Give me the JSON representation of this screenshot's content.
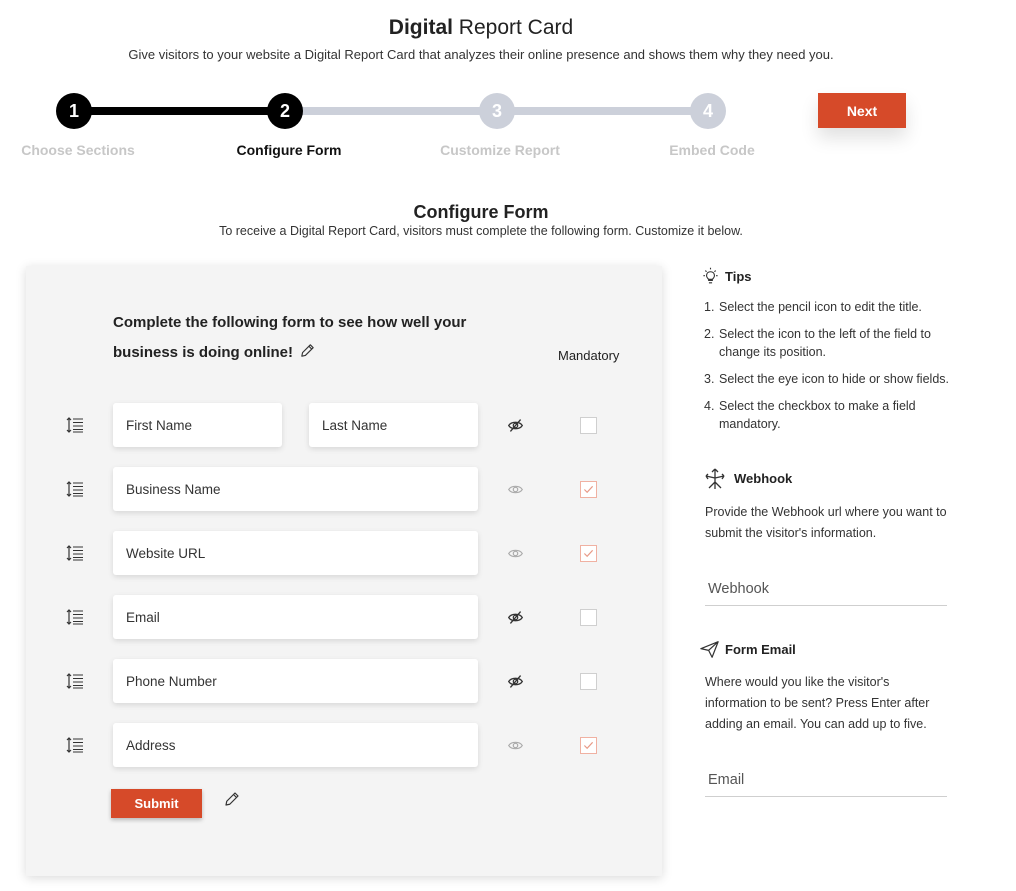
{
  "header": {
    "title_bold": "Digital",
    "title_rest": " Report Card",
    "subtitle": "Give visitors to your website a Digital Report Card that analyzes their online presence and shows them why they need you."
  },
  "steps": [
    {
      "number": "1",
      "label": "Choose Sections",
      "state": "done"
    },
    {
      "number": "2",
      "label": "Configure Form",
      "state": "active"
    },
    {
      "number": "3",
      "label": "Customize Report",
      "state": "pending"
    },
    {
      "number": "4",
      "label": "Embed Code",
      "state": "pending"
    }
  ],
  "next_label": "Next",
  "section": {
    "title": "Configure Form",
    "subtitle": "To receive a Digital Report Card, visitors must complete the following form. Customize it below."
  },
  "form": {
    "heading": "Complete the following form to see how well your business is doing online!",
    "mandatory_label": "Mandatory",
    "rows": [
      {
        "fields": [
          "First Name",
          "Last Name"
        ],
        "visible": false,
        "mandatory": false
      },
      {
        "fields": [
          "Business Name"
        ],
        "visible": true,
        "mandatory": true
      },
      {
        "fields": [
          "Website URL"
        ],
        "visible": true,
        "mandatory": true
      },
      {
        "fields": [
          "Email"
        ],
        "visible": false,
        "mandatory": false
      },
      {
        "fields": [
          "Phone Number"
        ],
        "visible": false,
        "mandatory": false
      },
      {
        "fields": [
          "Address"
        ],
        "visible": true,
        "mandatory": true
      }
    ],
    "submit_label": "Submit"
  },
  "tips": {
    "title": "Tips",
    "items": [
      "Select the pencil icon to edit the title.",
      "Select the icon to the left of the field to change its position.",
      "Select the eye icon to hide or show fields.",
      "Select the checkbox to make a field mandatory."
    ]
  },
  "webhook": {
    "title": "Webhook",
    "description": "Provide the Webhook url where you want to submit the visitor's information.",
    "placeholder": "Webhook"
  },
  "form_email": {
    "title": "Form Email",
    "description": "Where would you like the visitor's information to be sent? Press Enter after adding an email. You can add up to five.",
    "placeholder": "Email"
  },
  "colors": {
    "accent": "#d64a29",
    "step_done": "#000000",
    "step_pending": "#ccd0da",
    "checkbox_checked": "#f0b1a2"
  }
}
